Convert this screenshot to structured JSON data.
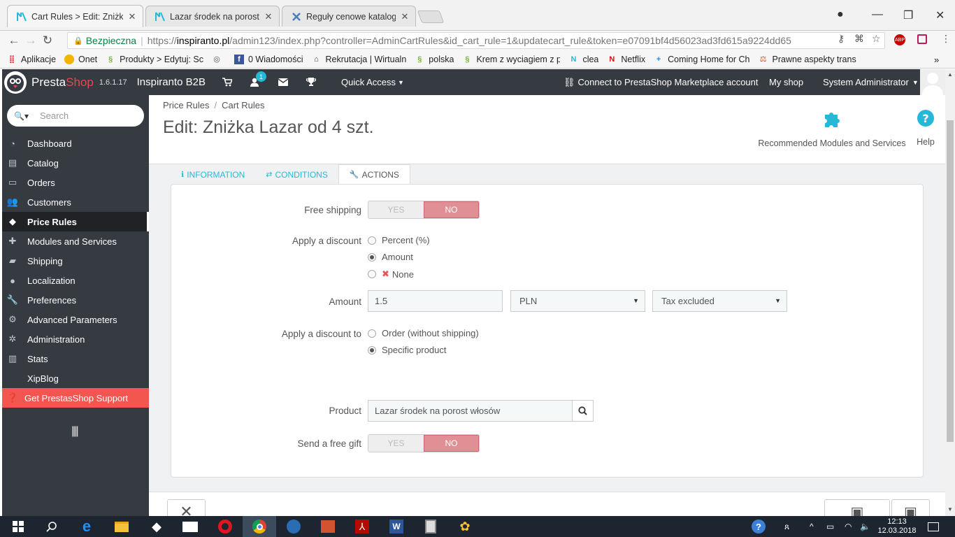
{
  "browser": {
    "tabs": [
      {
        "title": "Cart Rules > Edit: Zniżka",
        "icon": "prestashop-icon",
        "active": true
      },
      {
        "title": "Lazar środek na porost w",
        "icon": "prestashop-icon",
        "active": false
      },
      {
        "title": "Reguły cenowe katalogu",
        "icon": "tools-icon",
        "active": false
      }
    ],
    "secure_label": "Bezpieczna",
    "url_scheme": "https://",
    "url_host": "inspiranto.pl",
    "url_path": "/admin123/index.php?controller=AdminCartRules&id_cart_rule=1&updatecart_rule&token=e07091bf4d56023ad3fd615a9224dd65",
    "bookmarks": [
      "Aplikacje",
      "Onet",
      "Produkty > Edytuj: Sc",
      "",
      "0 Wiadomości",
      "Rekrutacja | Wirtualn",
      "polska",
      "Krem z wyciagiem z p",
      "clea",
      "Netflix",
      "Coming Home for Ch",
      "Prawne aspekty trans"
    ],
    "bookmarks_more": "»"
  },
  "header": {
    "brand_presta": "Presta",
    "brand_shop": "Shop",
    "version": "1.6.1.17",
    "shop_name": "Inspiranto B2B",
    "notification_count": "1",
    "quick_access": "Quick Access",
    "marketplace": "Connect to PrestaShop Marketplace account",
    "my_shop": "My shop",
    "user": "System Administrator"
  },
  "sidebar": {
    "search_placeholder": "Search",
    "items": [
      {
        "label": "Dashboard",
        "icon": "dashboard-icon"
      },
      {
        "label": "Catalog",
        "icon": "book-icon"
      },
      {
        "label": "Orders",
        "icon": "credit-card-icon"
      },
      {
        "label": "Customers",
        "icon": "users-icon"
      },
      {
        "label": "Price Rules",
        "icon": "tags-icon",
        "active": true
      },
      {
        "label": "Modules and Services",
        "icon": "puzzle-icon"
      },
      {
        "label": "Shipping",
        "icon": "truck-icon"
      },
      {
        "label": "Localization",
        "icon": "globe-icon"
      },
      {
        "label": "Preferences",
        "icon": "wrench-icon"
      },
      {
        "label": "Advanced Parameters",
        "icon": "cogs-icon"
      },
      {
        "label": "Administration",
        "icon": "gear-icon"
      },
      {
        "label": "Stats",
        "icon": "bar-chart-icon"
      },
      {
        "label": "XipBlog",
        "icon": ""
      }
    ],
    "support": "Get PrestasShop Support"
  },
  "page": {
    "breadcrumb": [
      "Price Rules",
      "Cart Rules"
    ],
    "title": "Edit: Zniżka Lazar od 4 szt.",
    "recommended": "Recommended Modules and Services",
    "help": "Help",
    "tabs": [
      "Information",
      "Conditions",
      "Actions"
    ]
  },
  "form": {
    "free_shipping_label": "Free shipping",
    "yes": "YES",
    "no": "NO",
    "apply_discount_label": "Apply a discount",
    "discount_options": [
      "Percent (%)",
      "Amount",
      "None"
    ],
    "discount_selected": "Amount",
    "amount_label": "Amount",
    "amount_value": "1.5",
    "currency": "PLN",
    "tax": "Tax excluded",
    "apply_to_label": "Apply a discount to",
    "apply_to_options": [
      "Order (without shipping)",
      "Specific product"
    ],
    "apply_to_selected": "Specific product",
    "product_label": "Product",
    "product_value": "Lazar środek na porost włosów",
    "free_gift_label": "Send a free gift"
  },
  "taskbar": {
    "time": "12:13",
    "date": "12.03.2018"
  },
  "colors": {
    "ps_dark": "#363a41",
    "ps_blue": "#25b9d7",
    "ps_red": "#df4a56",
    "switch_no": "#e08f95",
    "support_red": "#f2564f"
  }
}
